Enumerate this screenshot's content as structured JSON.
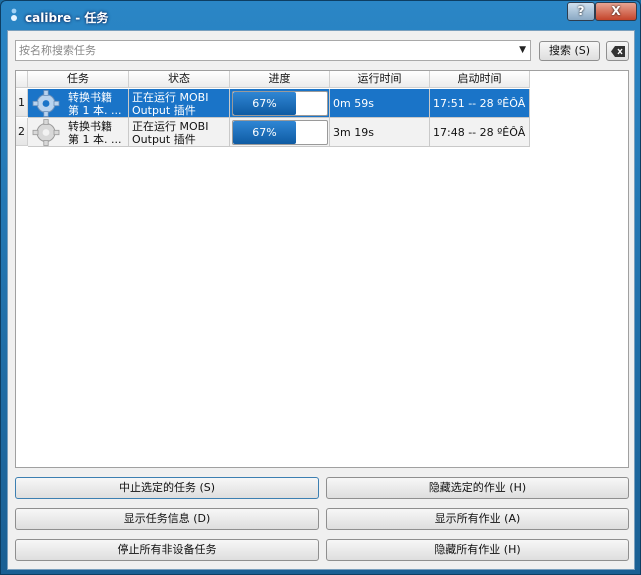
{
  "window": {
    "title": "calibre - 任务",
    "help_label": "?",
    "close_label": "X"
  },
  "search": {
    "placeholder": "按名称搜索任务",
    "button_label": "搜索 (S)"
  },
  "table": {
    "columns": [
      "任务",
      "状态",
      "进度",
      "运行时间",
      "启动时间"
    ],
    "rows": [
      {
        "num": "1",
        "task_line1": "转换书籍",
        "task_line2": "第 1 本. ...",
        "status_line1": "正在运行 MOBI",
        "status_line2": "Output 插件",
        "progress": 0.67,
        "progress_label": "67%",
        "runtime": "0m 59s",
        "start": "17:51 -- 28 ºÊÔÂ",
        "selected": true
      },
      {
        "num": "2",
        "task_line1": "转换书籍",
        "task_line2": "第 1 本. ...",
        "status_line1": "正在运行 MOBI",
        "status_line2": "Output 插件",
        "progress": 0.67,
        "progress_label": "67%",
        "runtime": "3m 19s",
        "start": "17:48 -- 28 ºÊÔÂ",
        "selected": false
      }
    ]
  },
  "actions": {
    "abort_selected": "中止选定的任务 (S)",
    "hide_selected": "隐藏选定的作业 (H)",
    "show_info": "显示任务信息 (D)",
    "show_all": "显示所有作业 (A)",
    "stop_non_device": "停止所有非设备任务",
    "hide_all": "隐藏所有作业 (H)"
  },
  "colors": {
    "selection": "#1a74c8",
    "title_bar": "#2a86c6",
    "progress": "#0f5ba3"
  }
}
